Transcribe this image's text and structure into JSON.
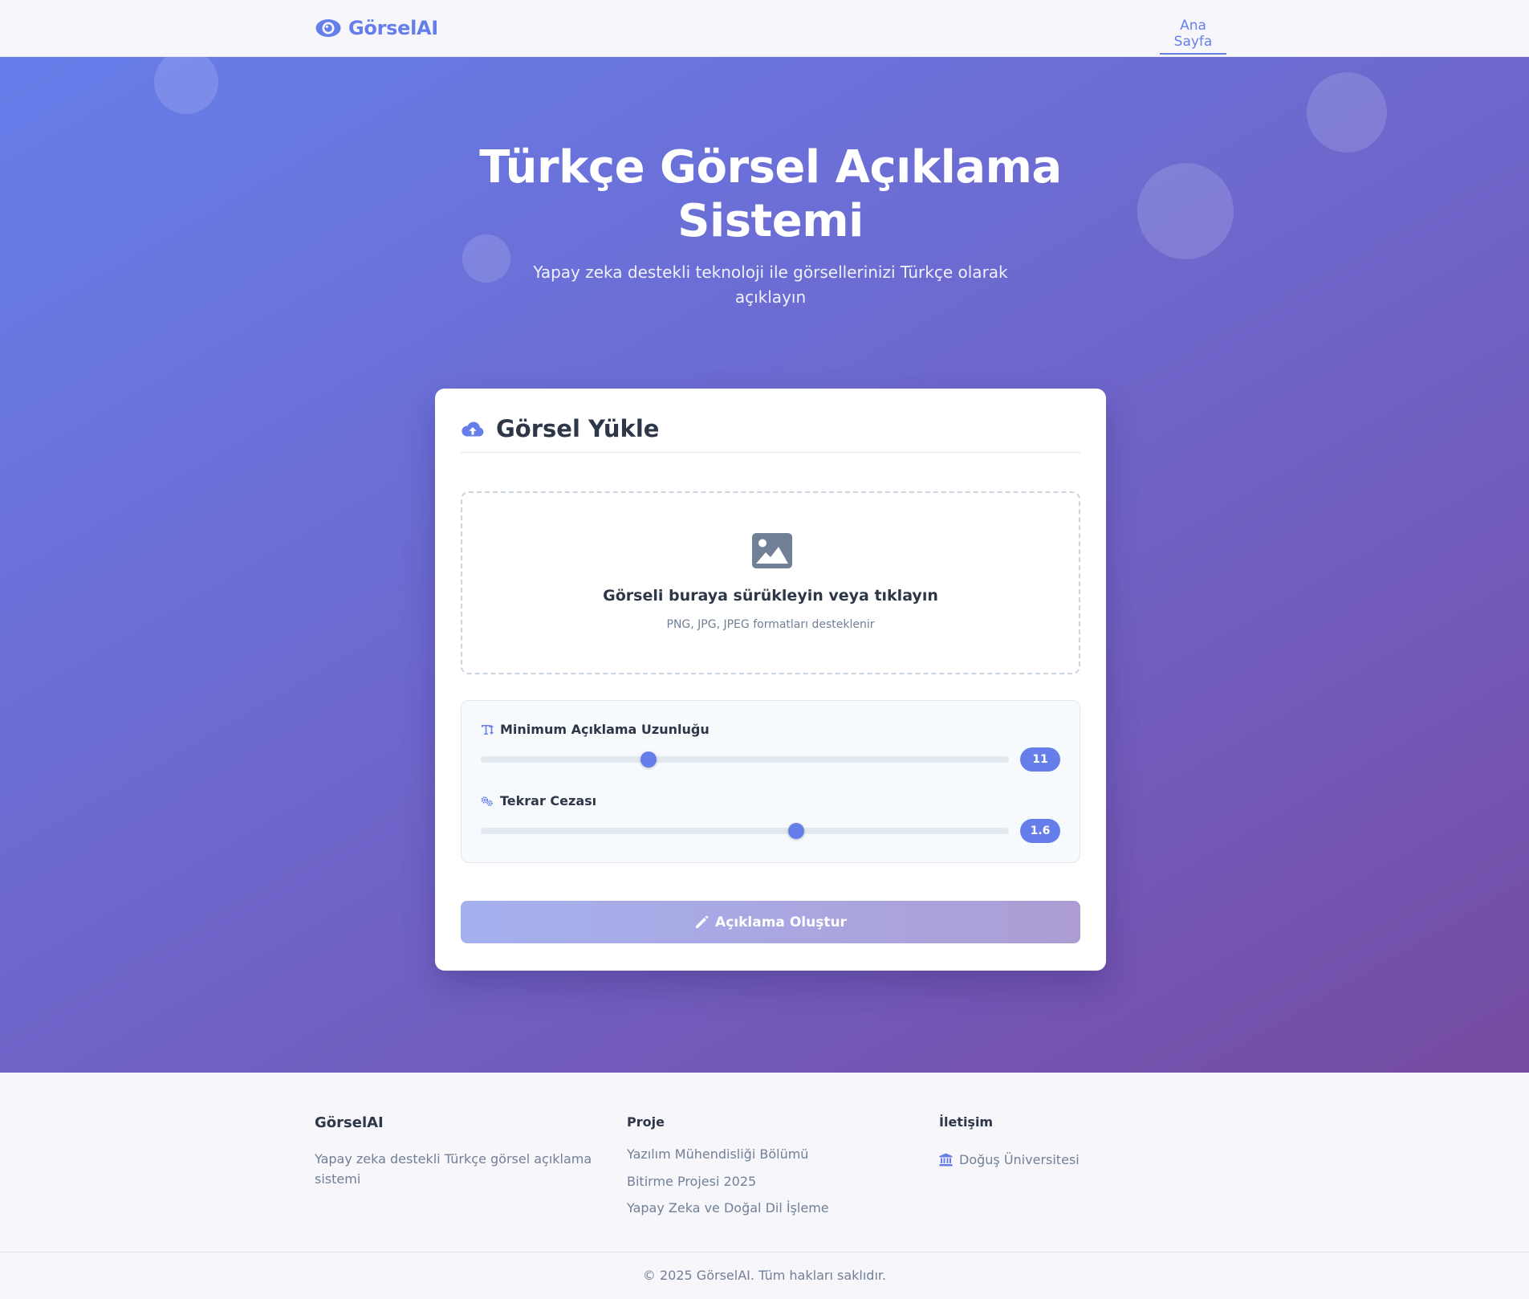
{
  "navbar": {
    "brand": "GörselAI",
    "link": "Ana Sayfa"
  },
  "hero": {
    "title": "Türkçe Görsel Açıklama Sistemi",
    "subtitle": "Yapay zeka destekli teknoloji ile görsellerinizi Türkçe olarak açıklayın"
  },
  "upload_card": {
    "title": "Görsel Yükle",
    "dropzone_text": "Görseli buraya sürükleyin veya tıklayın",
    "dropzone_hint": "PNG, JPG, JPEG formatları desteklenir",
    "settings": [
      {
        "label": "Minimum Açıklama Uzunluğu",
        "value": "11",
        "fraction": 0.318,
        "icon": "text-height-icon"
      },
      {
        "label": "Tekrar Cezası",
        "value": "1.6",
        "fraction": 0.597,
        "icon": "cogs-icon"
      }
    ],
    "button_label": "Açıklama Oluştur"
  },
  "footer": {
    "brand": {
      "heading": "GörselAI",
      "description": "Yapay zeka destekli Türkçe görsel açıklama sistemi"
    },
    "project": {
      "heading": "Proje",
      "items": [
        "Yazılım Mühendisliği Bölümü",
        "Bitirme Projesi 2025",
        "Yapay Zeka ve Doğal Dil İşleme"
      ]
    },
    "contact": {
      "heading": "İletişim",
      "university": "Doğuş Üniversitesi"
    },
    "copyright": "© 2025 GörselAI. Tüm hakları saklıdır."
  },
  "colors": {
    "primary": "#667eea",
    "secondary": "#764ba2",
    "text_dark": "#2d3748",
    "text_muted": "#718096"
  }
}
